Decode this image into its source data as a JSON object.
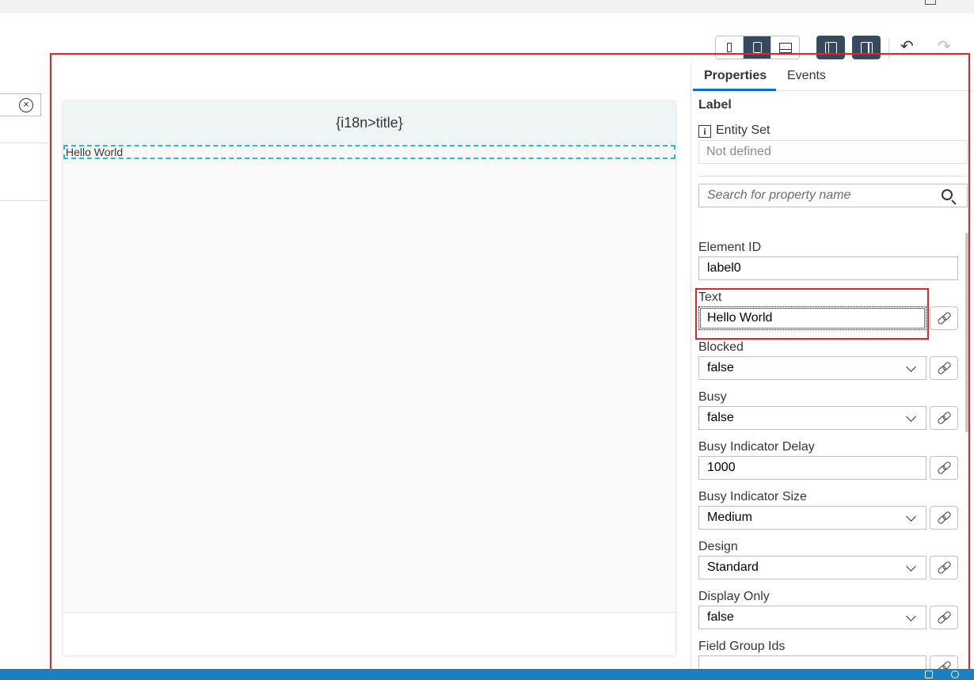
{
  "toolbar": {
    "device_buttons": [
      "phone-icon",
      "tablet-icon",
      "desktop-icon"
    ],
    "active_device": "tablet-icon",
    "undo_glyph": "↶",
    "redo_glyph": "↷"
  },
  "left_panel": {
    "clear_glyph": "×"
  },
  "canvas": {
    "page_title": "{i18n>title}",
    "label_text": "Hello World"
  },
  "properties": {
    "tabs": [
      {
        "label": "Properties",
        "active": true
      },
      {
        "label": "Events",
        "active": false
      }
    ],
    "control_type": "Label",
    "info_glyph": "i",
    "entity_set_label": "Entity Set",
    "entity_set_value": "Not defined",
    "search_placeholder": "Search for property name",
    "fields": [
      {
        "label": "Element ID",
        "value": "label0"
      },
      {
        "label": "Text",
        "value": "Hello World"
      },
      {
        "label": "Blocked",
        "value": "false"
      },
      {
        "label": "Busy",
        "value": "false"
      },
      {
        "label": "Busy Indicator Delay",
        "value": "1000"
      },
      {
        "label": "Busy Indicator Size",
        "value": "Medium"
      },
      {
        "label": "Design",
        "value": "Standard"
      },
      {
        "label": "Display Only",
        "value": "false"
      },
      {
        "label": "Field Group Ids",
        "value": ""
      }
    ]
  },
  "colors": {
    "accent": "#0a6ed1",
    "shell_button": "#354a5f",
    "highlight": "#e3242b",
    "selection": "#29b6e5",
    "statusbar": "#1b7fc4"
  }
}
